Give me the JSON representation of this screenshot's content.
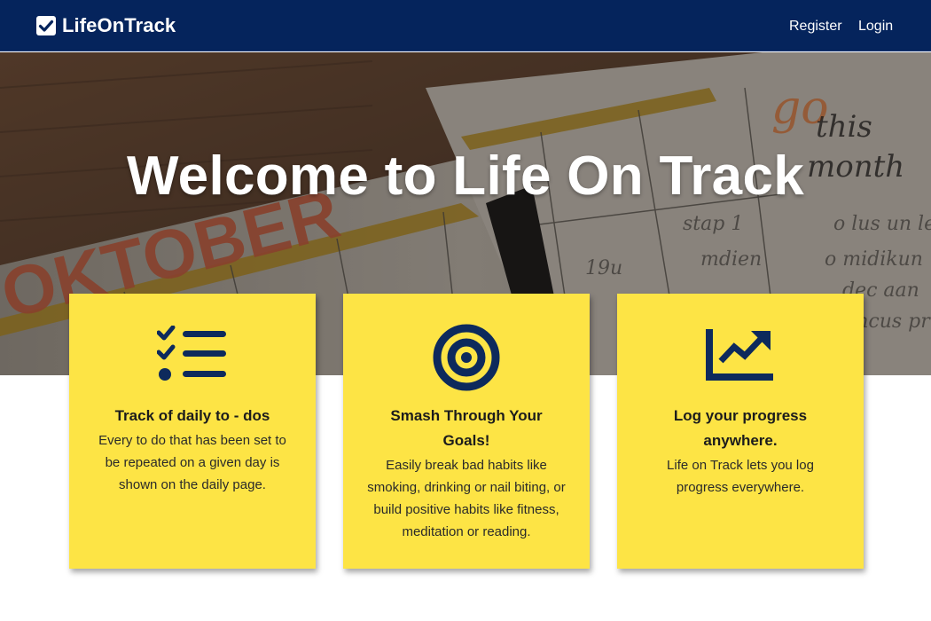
{
  "navbar": {
    "brand": "LifeOnTrack",
    "brand_icon": "checkbox-icon",
    "links": [
      {
        "label": "Register"
      },
      {
        "label": "Login"
      }
    ],
    "bg_color": "#05245c"
  },
  "hero": {
    "title": "Welcome to Life On Track"
  },
  "features": [
    {
      "icon": "checklist-icon",
      "title": "Track of daily to - dos",
      "text": "Every to do that has been set to be repeated on a given day is shown on the daily page."
    },
    {
      "icon": "target-icon",
      "title": "Smash Through Your Goals!",
      "text": "Easily break bad habits like smoking, drinking or nail biting, or build positive habits like fitness, meditation or reading."
    },
    {
      "icon": "chart-line-icon",
      "title": "Log your progress anywhere.",
      "text": "Life on Track lets you log progress everywhere."
    }
  ],
  "colors": {
    "card": "#fde445",
    "icon": "#0d2a5c"
  }
}
